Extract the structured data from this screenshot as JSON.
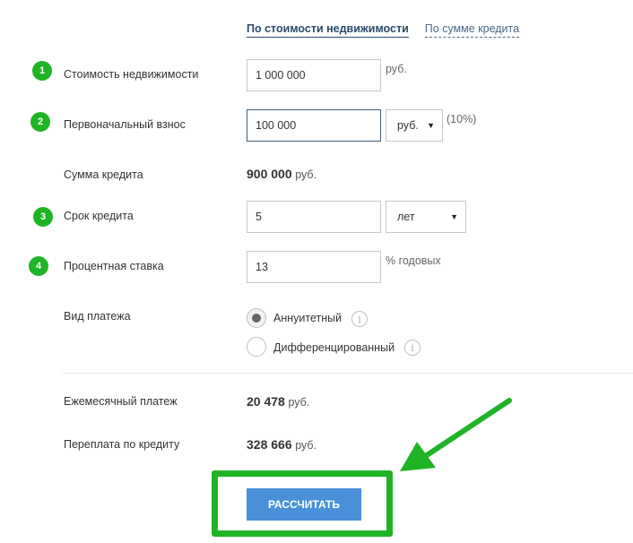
{
  "tabs": {
    "active": "По стоимости недвижимости",
    "inactive": "По сумме кредита"
  },
  "steps": [
    "1",
    "2",
    "3",
    "4"
  ],
  "fields": {
    "property_cost": {
      "label": "Стоимость недвижимости",
      "value": "1 000 000",
      "unit": "руб."
    },
    "down_payment": {
      "label": "Первоначальный взнос",
      "value": "100 000",
      "currency": "руб.",
      "percent": "(10%)"
    },
    "loan_amount": {
      "label": "Сумма кредита",
      "value": "900 000",
      "unit": "руб."
    },
    "term": {
      "label": "Срок кредита",
      "value": "5",
      "unit": "лет"
    },
    "rate": {
      "label": "Процентная ставка",
      "value": "13",
      "unit": "% годовых"
    },
    "payment_type": {
      "label": "Вид платежа",
      "options": [
        {
          "label": "Аннуитетный",
          "checked": true
        },
        {
          "label": "Дифференцированный",
          "checked": false
        }
      ]
    }
  },
  "results": {
    "monthly": {
      "label": "Ежемесячный платеж",
      "value": "20 478",
      "unit": "руб."
    },
    "overpay": {
      "label": "Переплата по кредиту",
      "value": "328 666",
      "unit": "руб."
    }
  },
  "button": {
    "label": "РАССЧИТАТЬ"
  },
  "icons": {
    "info": "info-icon",
    "caret": "caret-down-icon",
    "arrow": "arrow-pointer-icon"
  },
  "colors": {
    "badge": "#1fb426",
    "highlight": "#1fb426",
    "button": "#4a90d9",
    "active_tab": "#2a4a6b"
  }
}
